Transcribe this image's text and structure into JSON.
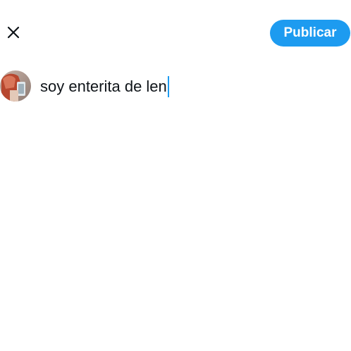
{
  "header": {
    "close_icon": "close-icon",
    "publish_label": "Publicar",
    "accent_color": "#1d9bf0"
  },
  "composer": {
    "avatar_icon": "user-avatar",
    "text": "soy enterita de len"
  }
}
